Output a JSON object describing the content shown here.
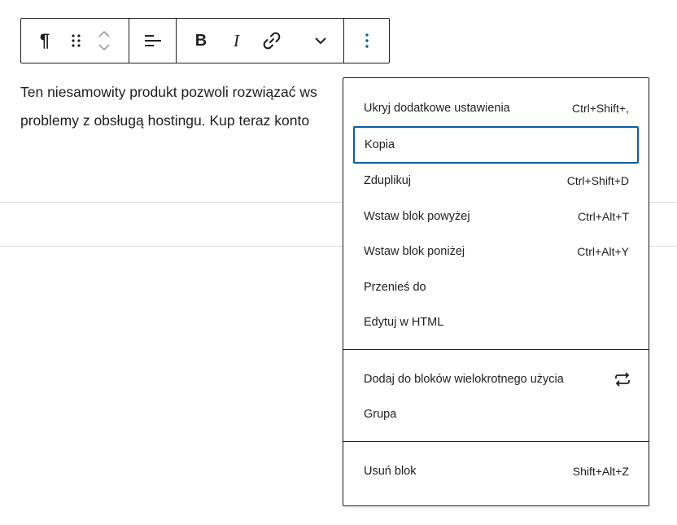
{
  "toolbar": {
    "paragraph_glyph": "¶",
    "bold_glyph": "B",
    "italic_glyph": "I",
    "icons": [
      "drag-handle-icon",
      "chevron-up-icon",
      "chevron-down-icon",
      "align-left-icon",
      "link-icon",
      "more-arrow-icon",
      "options-icon"
    ]
  },
  "editor": {
    "line1": "Ten niesamowity produkt pozwoli rozwiązać ws",
    "line2": "problemy z obsługą hostingu. Kup teraz konto"
  },
  "menu": {
    "group1": [
      {
        "label": "Ukryj dodatkowe ustawienia",
        "shortcut": "Ctrl+Shift+,"
      },
      {
        "label": "Kopia",
        "shortcut": ""
      },
      {
        "label": "Zduplikuj",
        "shortcut": "Ctrl+Shift+D"
      },
      {
        "label": "Wstaw blok powyżej",
        "shortcut": "Ctrl+Alt+T"
      },
      {
        "label": "Wstaw blok poniżej",
        "shortcut": "Ctrl+Alt+Y"
      },
      {
        "label": "Przenieś do",
        "shortcut": ""
      },
      {
        "label": "Edytuj w HTML",
        "shortcut": ""
      }
    ],
    "group2": [
      {
        "label": "Dodaj do bloków wielokrotnego użycia",
        "icon": "reusable-icon"
      },
      {
        "label": "Grupa"
      }
    ],
    "group3": [
      {
        "label": "Usuń blok",
        "shortcut": "Shift+Alt+Z"
      }
    ]
  },
  "colors": {
    "accent": "#0a5da4",
    "border": "#1e1e1e",
    "divider": "#dcdcdc"
  }
}
